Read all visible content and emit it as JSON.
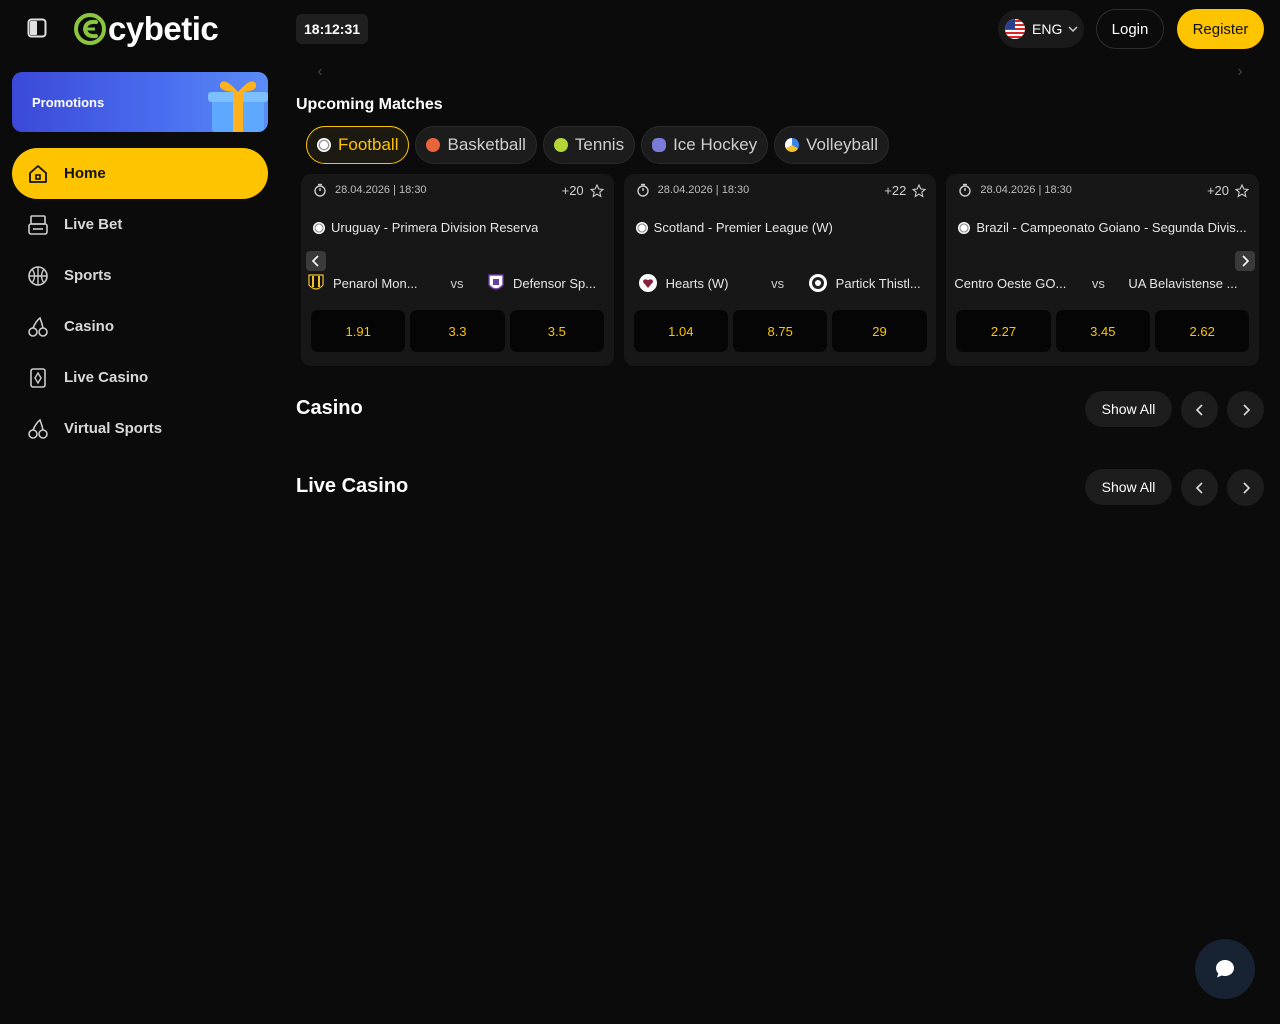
{
  "header": {
    "logo_text": "cybetic",
    "clock": "18:12:31",
    "language": "ENG",
    "login_label": "Login",
    "register_label": "Register"
  },
  "sidebar": {
    "promo_label": "Promotions",
    "items": [
      {
        "label": "Home",
        "icon": "home-icon",
        "active": true
      },
      {
        "label": "Live Bet",
        "icon": "live-bet-icon"
      },
      {
        "label": "Sports",
        "icon": "basketball-icon"
      },
      {
        "label": "Casino",
        "icon": "cherries-icon"
      },
      {
        "label": "Live Casino",
        "icon": "card-diamond-icon"
      },
      {
        "label": "Virtual Sports",
        "icon": "cherries-icon"
      }
    ]
  },
  "upcoming": {
    "title": "Upcoming Matches",
    "tabs": [
      {
        "label": "Football",
        "color": "#e8e8e8",
        "active": true
      },
      {
        "label": "Basketball",
        "color": "#e8643a"
      },
      {
        "label": "Tennis",
        "color": "#b5d437"
      },
      {
        "label": "Ice Hockey",
        "color": "#7a7ad8"
      },
      {
        "label": "Volleyball",
        "color": "#3a86e8"
      }
    ],
    "matches": [
      {
        "datetime": "28.04.2026 | 18:30",
        "more": "+20",
        "league": "Uruguay - Primera Division Reserva",
        "home": "Penarol Mon...",
        "away": "Defensor Sp...",
        "vs": "vs",
        "odds": [
          "1.91",
          "3.3",
          "3.5"
        ]
      },
      {
        "datetime": "28.04.2026 | 18:30",
        "more": "+22",
        "league": "Scotland - Premier League (W)",
        "home": "Hearts (W)",
        "away": "Partick Thistl...",
        "vs": "vs",
        "odds": [
          "1.04",
          "8.75",
          "29"
        ]
      },
      {
        "datetime": "28.04.2026 | 18:30",
        "more": "+20",
        "league": "Brazil - Campeonato Goiano - Segunda Divis...",
        "home": "Centro Oeste GO...",
        "away": "UA Belavistense ...",
        "vs": "vs",
        "odds": [
          "2.27",
          "3.45",
          "2.62"
        ]
      }
    ]
  },
  "casino": {
    "title": "Casino",
    "show_all": "Show All"
  },
  "live_casino": {
    "title": "Live Casino",
    "show_all": "Show All"
  },
  "colors": {
    "accent": "#ffc400",
    "background": "#0b0b0b",
    "card": "#171717"
  }
}
